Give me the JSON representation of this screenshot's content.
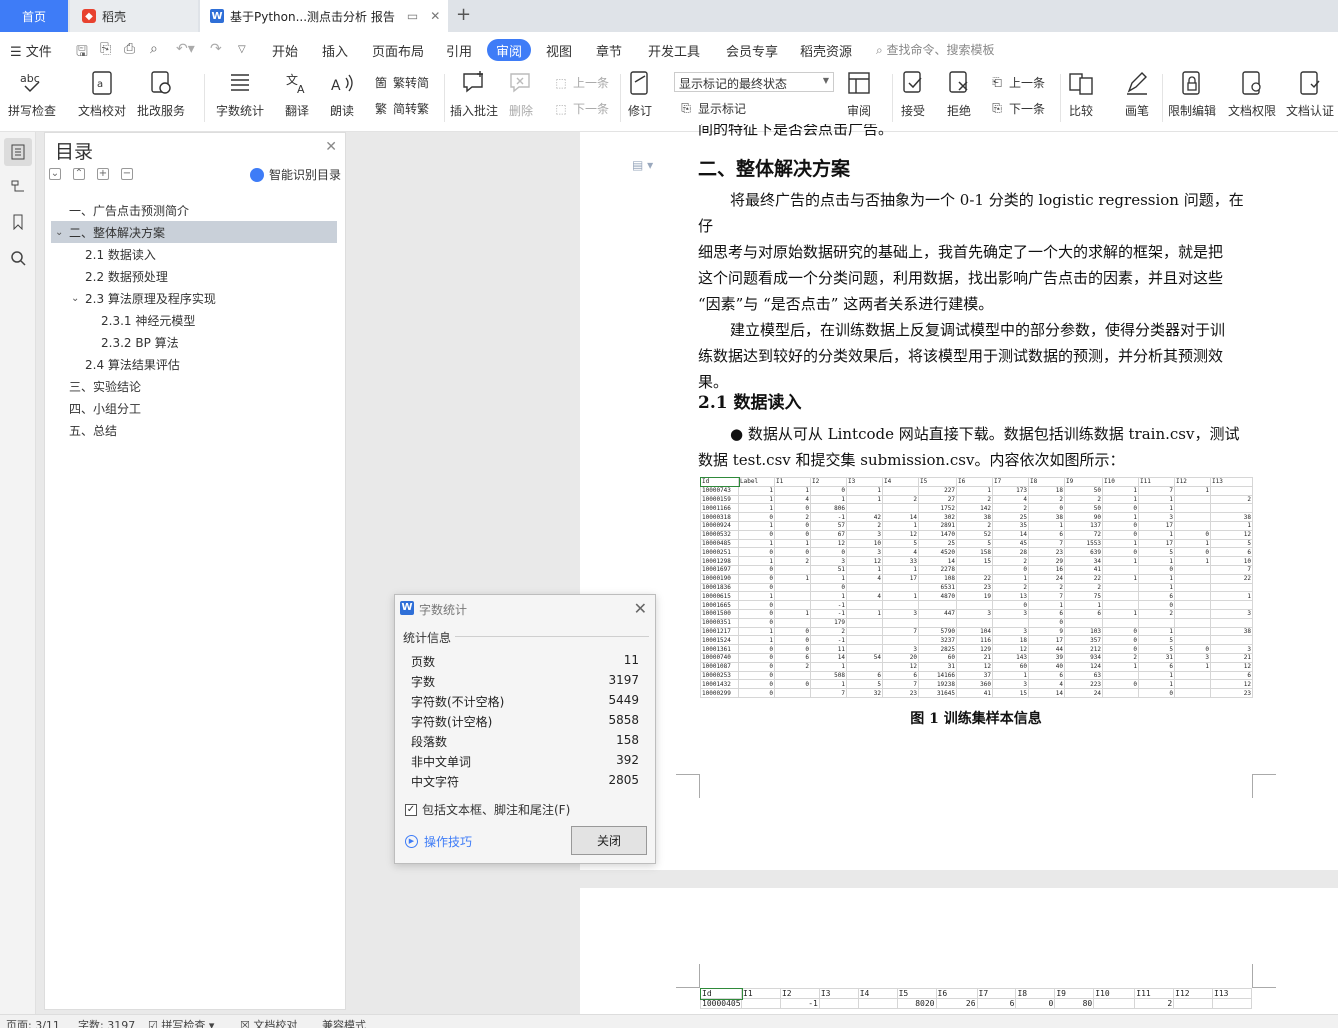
{
  "tabs": {
    "home": "首页",
    "daoke": "稻壳",
    "doc": "基于Python...测点击分析 报告"
  },
  "menu": {
    "file": "文件",
    "items": [
      "开始",
      "插入",
      "页面布局",
      "引用",
      "审阅",
      "视图",
      "章节",
      "开发工具",
      "会员专享",
      "稻壳资源"
    ],
    "active": "审阅",
    "search_placeholder": "查找命令、搜索模板"
  },
  "ribbon": {
    "spell_check": "拼写检查",
    "doc_proof": "文档校对",
    "batch_service": "批改服务",
    "word_count": "字数统计",
    "translate": "翻译",
    "read_aloud": "朗读",
    "trad_simp": "繁转简",
    "simp_trad": "简转繁",
    "insert_comment": "插入批注",
    "delete": "删除",
    "prev_comment": "上一条",
    "next_comment": "下一条",
    "track_changes": "修订",
    "markup_state": "显示标记的最终状态",
    "show_markup": "显示标记",
    "review": "审阅",
    "accept": "接受",
    "reject": "拒绝",
    "prev_change": "上一条",
    "next_change": "下一条",
    "compare": "比较",
    "pen": "画笔",
    "restrict_edit": "限制编辑",
    "doc_rights": "文档权限",
    "doc_certify": "文档认证"
  },
  "toc": {
    "title": "目录",
    "smart_label": "智能识别目录",
    "items": [
      {
        "label": "一、广告点击预测简介",
        "level": 1
      },
      {
        "label": "二、整体解决方案",
        "level": 1
      },
      {
        "label": "2.1  数据读入",
        "level": 2
      },
      {
        "label": "2.2  数据预处理",
        "level": 2
      },
      {
        "label": "2.3  算法原理及程序实现",
        "level": 2
      },
      {
        "label": "2.3.1  神经元模型",
        "level": 3
      },
      {
        "label": "2.3.2 BP 算法",
        "level": 3
      },
      {
        "label": "2.4  算法结果评估",
        "level": 2
      },
      {
        "label": "三、实验结论",
        "level": 1
      },
      {
        "label": "四、小组分工",
        "level": 1
      },
      {
        "label": "五、总结",
        "level": 1
      }
    ]
  },
  "doc": {
    "cut_line": "间的特征下是否会点击广告。",
    "heading": "二、整体解决方案",
    "para1": [
      "将最终广告的点击与否抽象为一个 0-1 分类的 logistic regression 问题，在仔",
      "细思考与对原始数据研究的基础上，我首先确定了一个大的求解的框架，就是把",
      "这个问题看成一个分类问题，利用数据，找出影响广告点击的因素，并且对这些",
      "“因素”与 “是否点击” 这两者关系进行建模。"
    ],
    "para2": [
      "建立模型后，在训练数据上反复调试模型中的部分参数，使得分类器对于训",
      "练数据达到较好的分类效果后，将该模型用于测试数据的预测，并分析其预测效",
      "果。"
    ],
    "sub_heading": "2.1  数据读入",
    "para3": [
      "●  数据从可从 Lintcode 网站直接下载。数据包括训练数据 train.csv，测试",
      "数据 test.csv 和提交集 submission.csv。内容依次如图所示："
    ],
    "caption": "图 1 训练集样本信息",
    "table_header": [
      "Id",
      "Label",
      "I1",
      "I2",
      "I3",
      "I4",
      "I5",
      "I6",
      "I7",
      "I8",
      "I9",
      "I10",
      "I11",
      "I12",
      "I13"
    ],
    "table_rows": [
      [
        "10000743",
        "1",
        "1",
        "0",
        "1",
        "",
        "227",
        "1",
        "173",
        "18",
        "50",
        "1",
        "7",
        "1",
        ""
      ],
      [
        "10000159",
        "1",
        "4",
        "1",
        "1",
        "2",
        "27",
        "2",
        "4",
        "2",
        "2",
        "1",
        "1",
        "",
        "2"
      ],
      [
        "10001166",
        "1",
        "0",
        "806",
        "",
        "",
        "1752",
        "142",
        "2",
        "0",
        "50",
        "0",
        "1",
        "",
        ""
      ],
      [
        "10000318",
        "0",
        "2",
        "-1",
        "42",
        "14",
        "302",
        "38",
        "25",
        "38",
        "90",
        "1",
        "3",
        "",
        "38"
      ],
      [
        "10000924",
        "1",
        "0",
        "57",
        "2",
        "1",
        "2891",
        "2",
        "35",
        "1",
        "137",
        "0",
        "17",
        "",
        "1"
      ],
      [
        "10000532",
        "0",
        "0",
        "67",
        "3",
        "12",
        "1470",
        "52",
        "14",
        "6",
        "72",
        "0",
        "1",
        "0",
        "12"
      ],
      [
        "10000485",
        "1",
        "1",
        "12",
        "10",
        "5",
        "25",
        "5",
        "45",
        "7",
        "1553",
        "1",
        "17",
        "1",
        "5"
      ],
      [
        "10000251",
        "0",
        "0",
        "0",
        "3",
        "4",
        "4520",
        "158",
        "28",
        "23",
        "639",
        "0",
        "5",
        "0",
        "6"
      ],
      [
        "10001298",
        "1",
        "2",
        "3",
        "12",
        "33",
        "14",
        "15",
        "2",
        "29",
        "34",
        "1",
        "1",
        "1",
        "10"
      ],
      [
        "10001697",
        "0",
        "",
        "51",
        "1",
        "1",
        "2278",
        "",
        "0",
        "16",
        "41",
        "",
        "0",
        "",
        "7"
      ],
      [
        "10000190",
        "0",
        "1",
        "1",
        "4",
        "17",
        "108",
        "22",
        "1",
        "24",
        "22",
        "1",
        "1",
        "",
        "22"
      ],
      [
        "10001836",
        "0",
        "",
        "0",
        "",
        "",
        "6531",
        "23",
        "2",
        "2",
        "2",
        "",
        "1",
        "",
        ""
      ],
      [
        "10000615",
        "1",
        "",
        "1",
        "4",
        "1",
        "4870",
        "19",
        "13",
        "7",
        "75",
        "",
        "6",
        "",
        "1"
      ],
      [
        "10001665",
        "0",
        "",
        "-1",
        "",
        "",
        "",
        "",
        "0",
        "1",
        "1",
        "",
        "0",
        "",
        ""
      ],
      [
        "10001500",
        "0",
        "1",
        "-1",
        "1",
        "3",
        "447",
        "3",
        "3",
        "6",
        "6",
        "1",
        "2",
        "",
        "3"
      ],
      [
        "10000351",
        "0",
        "",
        "179",
        "",
        "",
        "",
        "",
        "",
        "0",
        "",
        "",
        "",
        "",
        ""
      ],
      [
        "10001217",
        "1",
        "0",
        "2",
        "",
        "7",
        "5790",
        "104",
        "3",
        "9",
        "103",
        "0",
        "1",
        "",
        "38"
      ],
      [
        "10001524",
        "1",
        "0",
        "-1",
        "",
        "",
        "3237",
        "116",
        "18",
        "17",
        "357",
        "0",
        "5",
        "",
        ""
      ],
      [
        "10001361",
        "0",
        "0",
        "11",
        "",
        "3",
        "2825",
        "129",
        "12",
        "44",
        "212",
        "0",
        "5",
        "0",
        "3"
      ],
      [
        "10000740",
        "0",
        "6",
        "14",
        "54",
        "20",
        "60",
        "21",
        "143",
        "39",
        "934",
        "2",
        "31",
        "3",
        "21"
      ],
      [
        "10001087",
        "0",
        "2",
        "1",
        "",
        "12",
        "31",
        "12",
        "60",
        "40",
        "124",
        "1",
        "6",
        "1",
        "12"
      ],
      [
        "10000253",
        "0",
        "",
        "508",
        "6",
        "6",
        "14166",
        "37",
        "1",
        "6",
        "63",
        "",
        "1",
        "",
        "6"
      ],
      [
        "10001432",
        "0",
        "0",
        "1",
        "5",
        "7",
        "19238",
        "360",
        "3",
        "4",
        "223",
        "0",
        "1",
        "",
        "12"
      ],
      [
        "10000299",
        "0",
        "",
        "7",
        "32",
        "23",
        "31645",
        "41",
        "15",
        "14",
        "24",
        "",
        "0",
        "",
        "23"
      ]
    ],
    "table2_header": [
      "Id",
      "I1",
      "I2",
      "I3",
      "I4",
      "I5",
      "I6",
      "I7",
      "I8",
      "I9",
      "I10",
      "I11",
      "I12",
      "I13"
    ],
    "table2_rows": [
      [
        "10000405",
        "",
        "-1",
        "",
        "",
        "8020",
        "26",
        "6",
        "0",
        "80",
        "",
        "2",
        "",
        ""
      ]
    ]
  },
  "word_count": {
    "title": "字数统计",
    "section": "统计信息",
    "rows": [
      {
        "label": "页数",
        "value": "11"
      },
      {
        "label": "字数",
        "value": "3197"
      },
      {
        "label": "字符数(不计空格)",
        "value": "5449"
      },
      {
        "label": "字符数(计空格)",
        "value": "5858"
      },
      {
        "label": "段落数",
        "value": "158"
      },
      {
        "label": "非中文单词",
        "value": "392"
      },
      {
        "label": "中文字符",
        "value": "2805"
      }
    ],
    "include_label": "包括文本框、脚注和尾注(F)",
    "include_checked": true,
    "tips": "操作技巧",
    "close": "关闭"
  },
  "status": {
    "page": "页面: 3/11",
    "words": "字数: 3197",
    "spell": "拼写检查",
    "proof": "文档校对",
    "compat": "兼容模式"
  },
  "colors": {
    "accent": "#3e7cf7",
    "toc_selected": "#c9d0d9"
  }
}
